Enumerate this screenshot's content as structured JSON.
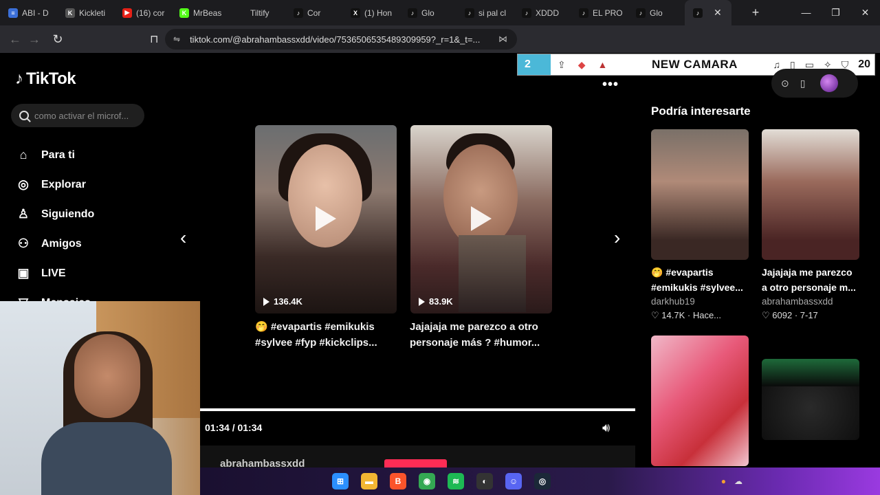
{
  "browser": {
    "tabs": [
      {
        "label": "ABI - D",
        "color": "#3b6fd8",
        "glyph": "≡"
      },
      {
        "label": "Kickleti",
        "color": "#555555",
        "glyph": "K"
      },
      {
        "label": "(16) cor",
        "color": "#e62117",
        "glyph": "▶"
      },
      {
        "label": "MrBeas",
        "color": "#53fc18",
        "glyph": "K"
      },
      {
        "label": "Tiltify",
        "color": "#1c1c1f",
        "glyph": ""
      },
      {
        "label": "Cor",
        "color": "#111111",
        "glyph": "♪"
      },
      {
        "label": "(1) Hon",
        "color": "#111111",
        "glyph": "X"
      },
      {
        "label": "Glo",
        "color": "#111111",
        "glyph": "♪"
      },
      {
        "label": "si pal cl",
        "color": "#111111",
        "glyph": "♪"
      },
      {
        "label": "XDDD",
        "color": "#111111",
        "glyph": "♪"
      },
      {
        "label": "EL PRO",
        "color": "#111111",
        "glyph": "♪"
      },
      {
        "label": "Glo",
        "color": "#111111",
        "glyph": "♪"
      }
    ],
    "active_tab_glyph": "♪",
    "url": "tiktok.com/@abrahambassxdd/video/7536506535489309959?_r=1&_t=...",
    "overlay": {
      "number": "2",
      "title": "NEW CAMARA",
      "right_number": "20"
    }
  },
  "tiktok": {
    "logo": "TikTok",
    "search_placeholder": "como activar el microf...",
    "nav": [
      {
        "label": "Para ti",
        "icon": "home-icon",
        "glyph": "⌂"
      },
      {
        "label": "Explorar",
        "icon": "compass-icon",
        "glyph": "◎"
      },
      {
        "label": "Siguiendo",
        "icon": "following-icon",
        "glyph": "♙"
      },
      {
        "label": "Amigos",
        "icon": "friends-icon",
        "glyph": "⚇"
      },
      {
        "label": "LIVE",
        "icon": "live-icon",
        "glyph": "▣"
      },
      {
        "label": "Mensajes",
        "icon": "messages-icon",
        "glyph": "▽"
      }
    ],
    "more_dots": "•••",
    "videos": [
      {
        "views": "136.4K",
        "caption": "🤭 #evapartis #emikukis #sylvee #fyp #kickclips..."
      },
      {
        "views": "83.9K",
        "caption": "Jajajaja me parezco a otro personaje más ? #humor..."
      }
    ],
    "player": {
      "time": "01:34 / 01:34",
      "progress_fraction": 1.0,
      "username": "abrahambassxdd"
    },
    "sidebar_title": "Podría interesarte",
    "recommended": [
      {
        "caption": "🤭 #evapartis #emikukis #sylvee...",
        "author": "darkhub19",
        "likes": "14.7K",
        "date": "Hace..."
      },
      {
        "caption": "Jajajaja me parezco a otro personaje m...",
        "author": "abrahambassxdd",
        "likes": "6092",
        "date": "7-17"
      }
    ],
    "like_glyph": "♡"
  },
  "taskbar": {
    "apps": [
      {
        "name": "windows-start-icon",
        "color": "#2b8fff",
        "glyph": "⊞"
      },
      {
        "name": "file-explorer-icon",
        "color": "#f2b632",
        "glyph": "▬"
      },
      {
        "name": "brave-icon",
        "color": "#fb542b",
        "glyph": "B"
      },
      {
        "name": "chrome-icon",
        "color": "#34a853",
        "glyph": "◉"
      },
      {
        "name": "spotify-icon",
        "color": "#1db954",
        "glyph": "≋"
      },
      {
        "name": "obs-icon",
        "color": "#333333",
        "glyph": "◐"
      },
      {
        "name": "discord-icon",
        "color": "#5865f2",
        "glyph": "☺"
      },
      {
        "name": "steam-icon",
        "color": "#1b2838",
        "glyph": "◎"
      }
    ]
  }
}
